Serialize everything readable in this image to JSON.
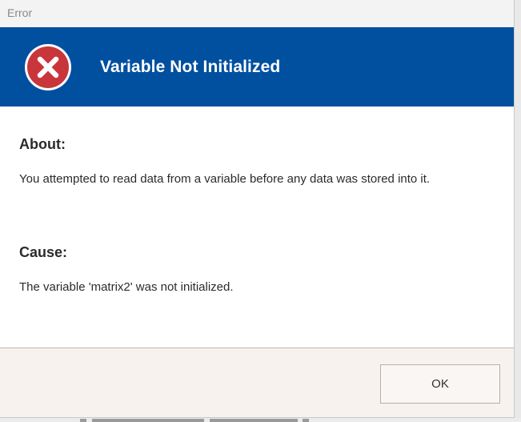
{
  "window": {
    "title": "Error"
  },
  "banner": {
    "icon": "error-x-icon",
    "icon_color": "#c8363c",
    "background": "#0150a0",
    "headline": "Variable Not Initialized"
  },
  "about": {
    "heading": "About:",
    "text": "You attempted to read data from a variable before any data was stored into it."
  },
  "cause": {
    "heading": "Cause:",
    "text": "The variable 'matrix2' was not initialized."
  },
  "footer": {
    "ok_label": "OK"
  }
}
